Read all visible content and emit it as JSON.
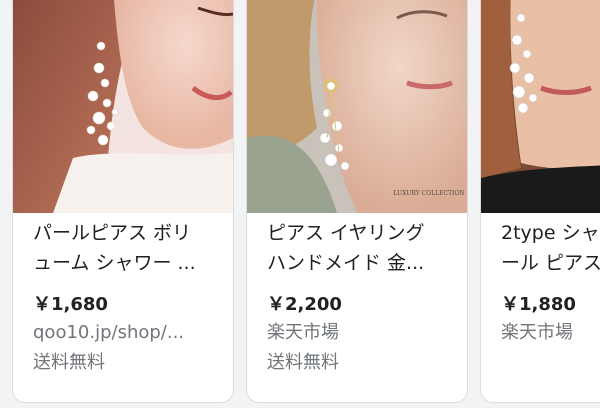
{
  "products": [
    {
      "title": "パールピアス ボリ\nューム シャワー ...",
      "price": "￥1,680",
      "source": "qoo10.jp/shop/...",
      "shipping": "送料無料",
      "image_label": "pearl-shower-earring-photo"
    },
    {
      "title": "ピアス イヤリング\nハンドメイド 金...",
      "price": "￥2,200",
      "source": "楽天市場",
      "shipping": "送料無料",
      "image_label": "handmade-pearl-earring-photo",
      "watermark": "LUXURY COLLECTION"
    },
    {
      "title": "2type シャ\nール ピアス",
      "price": "￥1,880",
      "source": "楽天市場",
      "image_label": "pearl-drop-earring-photo"
    }
  ]
}
